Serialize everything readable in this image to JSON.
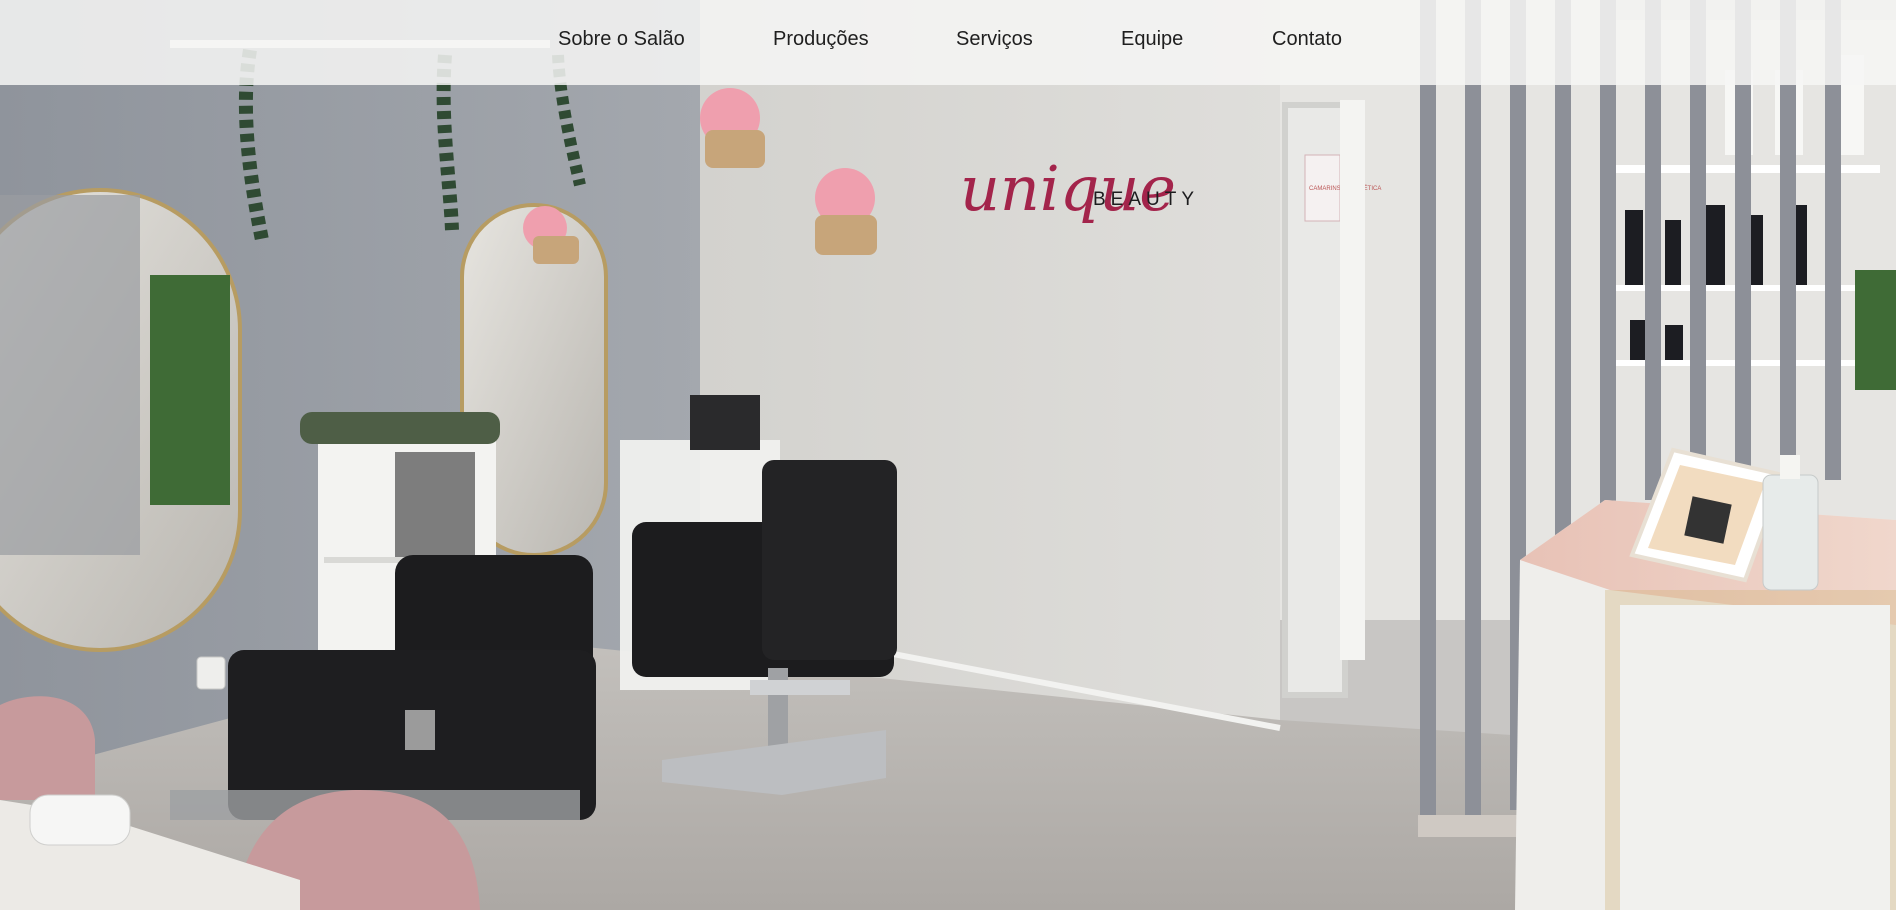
{
  "nav": {
    "items": [
      {
        "label": "Sobre o Salão"
      },
      {
        "label": "Produções"
      },
      {
        "label": "Serviços"
      },
      {
        "label": "Equipe"
      },
      {
        "label": "Contato"
      }
    ]
  },
  "hero": {
    "logo": {
      "script_text": "unique",
      "sub_text": "BEAUTY"
    },
    "door_sign": "CAMARINS DA ESTÉTICA"
  },
  "colors": {
    "nav_background": "#f6f6f5",
    "nav_text": "#1f1f1f",
    "logo_accent": "#a3244b",
    "wall_gray": "#9ea2a9",
    "wall_white": "#d9d8d4",
    "floor": "#b9b6b2",
    "chair_black": "#1c1c1e",
    "chair_pink": "#c79a9c",
    "flower_pink": "#ef9fae"
  }
}
